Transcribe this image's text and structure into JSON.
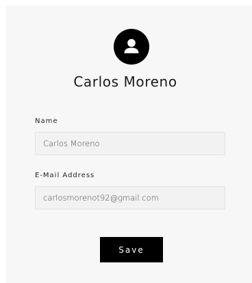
{
  "profile": {
    "display_name": "Carlos Moreno",
    "avatar_icon": "user-icon"
  },
  "form": {
    "name_label": "Name",
    "name_value": "Carlos Moreno",
    "email_label": "E-Mail Address",
    "email_value": "carlosmorenot92@gmail.com",
    "save_label": "Save"
  },
  "colors": {
    "card_background": "#f7f7f7",
    "input_background": "#f2f2f2",
    "button_background": "#000000",
    "button_text": "#ffffff"
  }
}
